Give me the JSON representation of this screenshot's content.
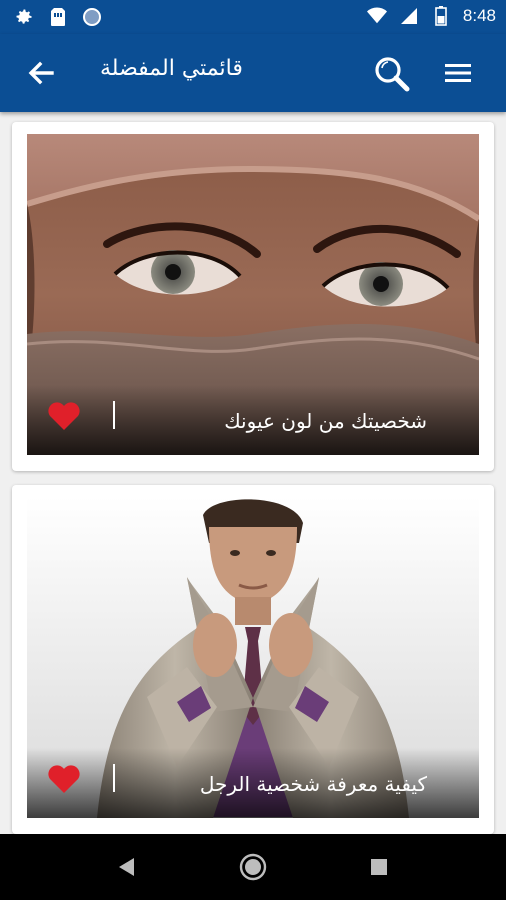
{
  "status_bar": {
    "time": "8:48",
    "left_icons": [
      "gear-icon",
      "sim-card-icon",
      "circle-icon"
    ],
    "right_icons": [
      "wifi-icon",
      "signal-icon",
      "battery-icon"
    ]
  },
  "app_bar": {
    "title": "قائمتي المفضلة",
    "back_icon": "arrow-left-icon",
    "search_icon": "search-icon",
    "menu_icon": "menu-icon",
    "color": "#0b4e94"
  },
  "cards": [
    {
      "caption": "شخصيتك من لون عيونك",
      "favorite": true
    },
    {
      "caption": "كيفية معرفة شخصية الرجل",
      "favorite": true
    }
  ],
  "nav_bar": {
    "buttons": [
      "back-triangle-icon",
      "home-circle-icon",
      "recents-square-icon"
    ]
  },
  "accent": {
    "heart": "#e0202a"
  }
}
